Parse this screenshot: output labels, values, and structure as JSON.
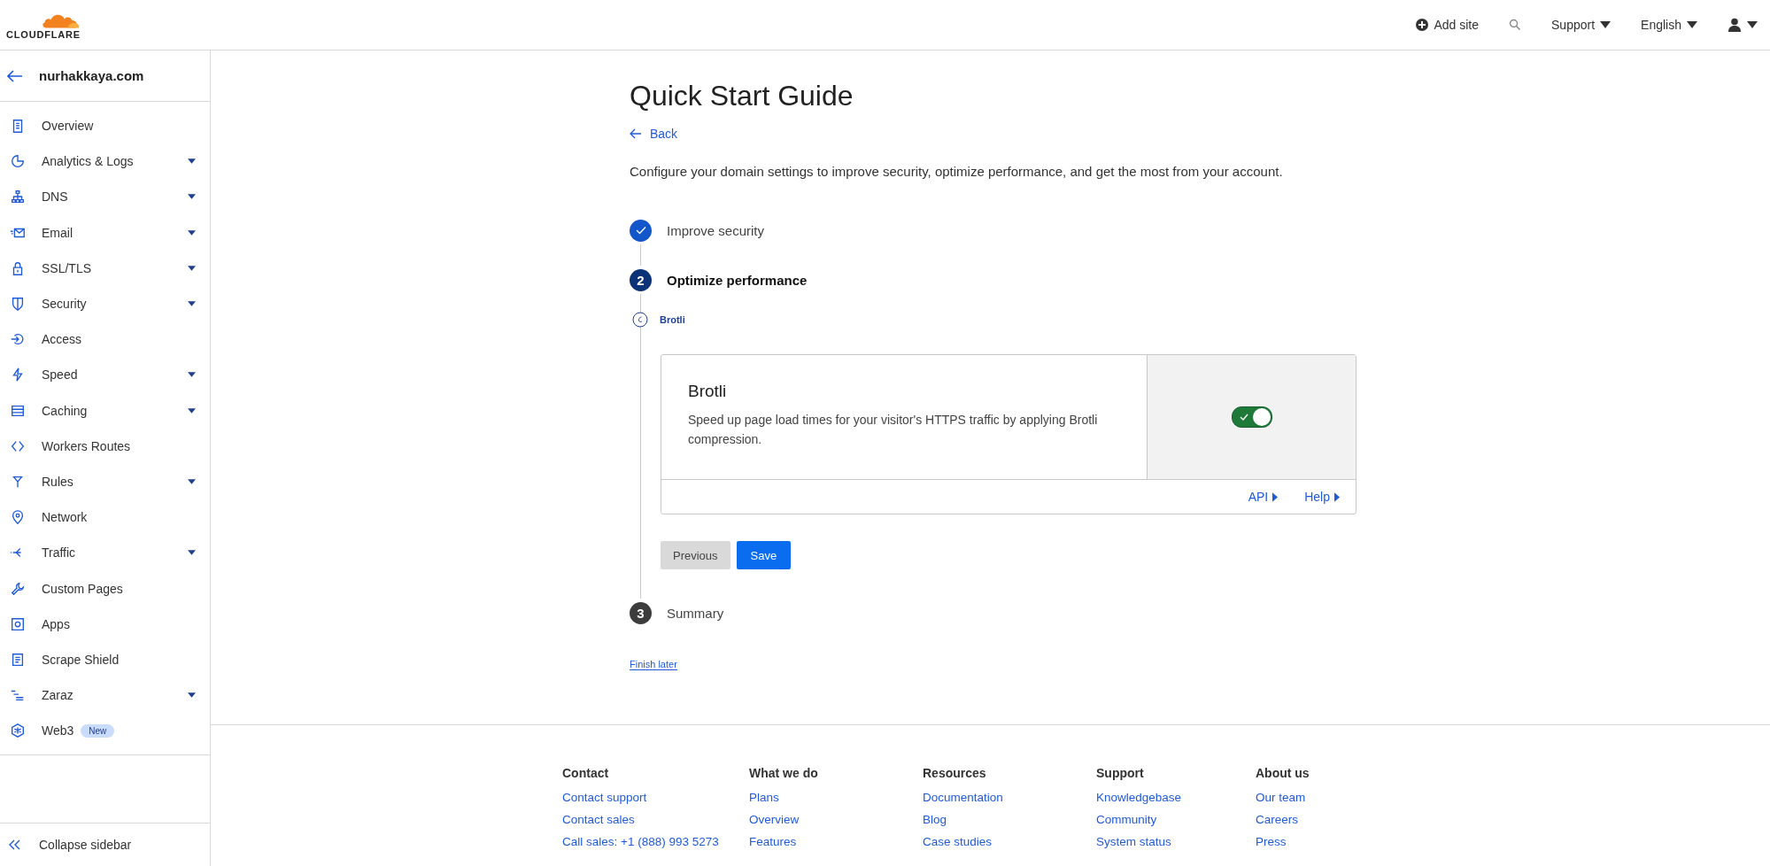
{
  "header": {
    "logo_text": "CLOUDFLARE",
    "add_site": "Add site",
    "support": "Support",
    "language": "English"
  },
  "sidebar": {
    "domain": "nurhakkaya.com",
    "items": [
      {
        "label": "Overview",
        "expandable": false
      },
      {
        "label": "Analytics & Logs",
        "expandable": true
      },
      {
        "label": "DNS",
        "expandable": true
      },
      {
        "label": "Email",
        "expandable": true
      },
      {
        "label": "SSL/TLS",
        "expandable": true
      },
      {
        "label": "Security",
        "expandable": true
      },
      {
        "label": "Access",
        "expandable": false
      },
      {
        "label": "Speed",
        "expandable": true
      },
      {
        "label": "Caching",
        "expandable": true
      },
      {
        "label": "Workers Routes",
        "expandable": false
      },
      {
        "label": "Rules",
        "expandable": true
      },
      {
        "label": "Network",
        "expandable": false
      },
      {
        "label": "Traffic",
        "expandable": true
      },
      {
        "label": "Custom Pages",
        "expandable": false
      },
      {
        "label": "Apps",
        "expandable": false
      },
      {
        "label": "Scrape Shield",
        "expandable": false
      },
      {
        "label": "Zaraz",
        "expandable": true
      },
      {
        "label": "Web3",
        "expandable": false,
        "badge": "New"
      }
    ],
    "collapse": "Collapse sidebar"
  },
  "main": {
    "title": "Quick Start Guide",
    "back": "Back",
    "description": "Configure your domain settings to improve security, optimize performance, and get the most from your account.",
    "steps": [
      {
        "label": "Improve security",
        "completed": true,
        "selected": false
      },
      {
        "number": "2",
        "label": "Optimize performance",
        "completed": false,
        "selected": true,
        "substep": "Brotli"
      },
      {
        "number": "3",
        "label": "Summary",
        "completed": false,
        "selected": false
      }
    ],
    "card": {
      "title": "Brotli",
      "text": "Speed up page load times for your visitor's HTTPS traffic by applying Brotli compression.",
      "on": true,
      "links": [
        "API",
        "Help"
      ]
    },
    "buttons": [
      "Previous",
      "Save"
    ],
    "finish_later": "Finish later"
  },
  "footer": {
    "columns": [
      {
        "heading": "Contact",
        "links": [
          "Contact support",
          "Contact sales",
          "Call sales: +1 (888) 993 5273"
        ]
      },
      {
        "heading": "What we do",
        "links": [
          "Plans",
          "Overview",
          "Features"
        ]
      },
      {
        "heading": "Resources",
        "links": [
          "Documentation",
          "Blog",
          "Case studies"
        ]
      },
      {
        "heading": "Support",
        "links": [
          "Knowledgebase",
          "Community",
          "System status"
        ]
      },
      {
        "heading": "About us",
        "links": [
          "Our team",
          "Careers",
          "Press"
        ]
      }
    ]
  }
}
